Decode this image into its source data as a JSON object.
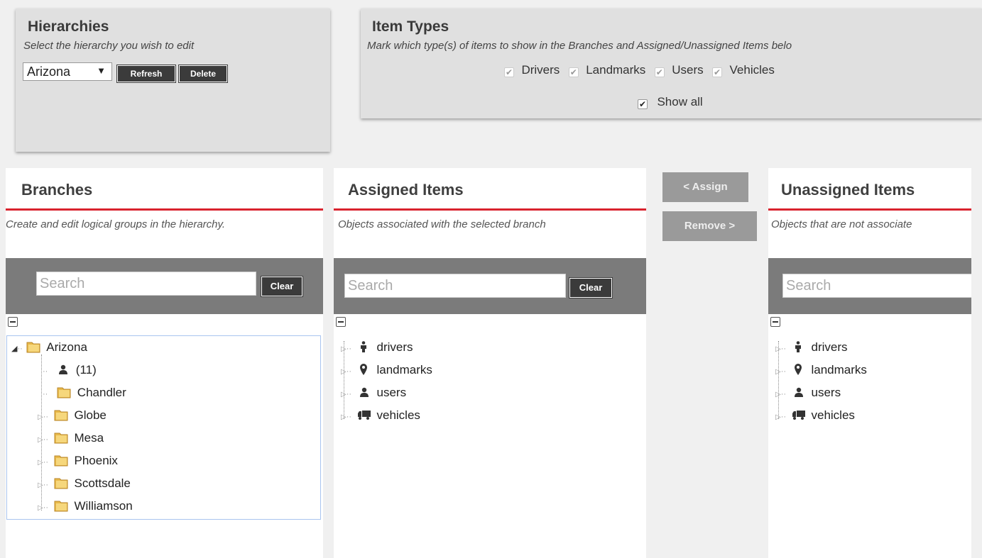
{
  "hierarchies": {
    "title": "Hierarchies",
    "subtitle": "Select the hierarchy you wish to edit",
    "selected": "Arizona",
    "refresh_label": "Refresh",
    "delete_label": "Delete"
  },
  "item_types": {
    "title": "Item Types",
    "subtitle": "Mark which type(s) of items to show in the Branches and Assigned/Unassigned Items belo",
    "options": [
      {
        "label": "Drivers",
        "checked": true
      },
      {
        "label": "Landmarks",
        "checked": true
      },
      {
        "label": "Users",
        "checked": true
      },
      {
        "label": "Vehicles",
        "checked": true
      }
    ],
    "show_all_label": "Show all",
    "show_all_checked": true
  },
  "branches": {
    "title": "Branches",
    "description": "Create and edit logical groups in the hierarchy.",
    "search_placeholder": "Search",
    "clear_label": "Clear",
    "root": "Arizona",
    "children": [
      "(11)",
      "Chandler",
      "Globe",
      "Mesa",
      "Phoenix",
      "Scottsdale",
      "Williamson"
    ]
  },
  "assigned": {
    "title": "Assigned Items",
    "description": "Objects associated with the selected branch",
    "search_placeholder": "Search",
    "clear_label": "Clear",
    "items": [
      "drivers",
      "landmarks",
      "users",
      "vehicles"
    ]
  },
  "actions": {
    "assign_label": "< Assign",
    "remove_label": "Remove >"
  },
  "unassigned": {
    "title": "Unassigned Items",
    "description": "Objects that are not associate",
    "search_placeholder": "Search",
    "items": [
      "drivers",
      "landmarks",
      "users",
      "vehicles"
    ]
  },
  "colors": {
    "accent_red": "#d9232e",
    "dark_button": "#3b3b3b",
    "search_band": "#7b7b7b",
    "disabled_button": "#9a9a9a"
  }
}
